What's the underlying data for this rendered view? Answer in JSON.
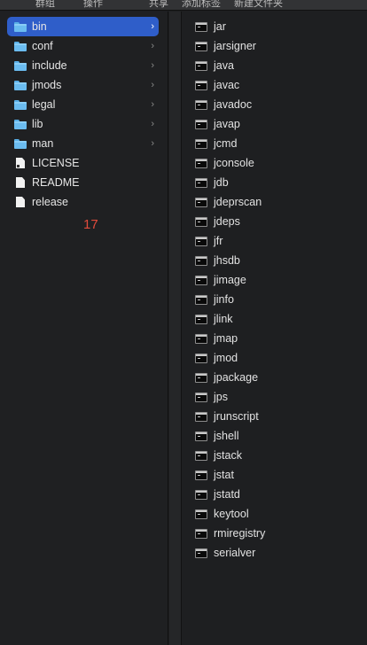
{
  "toolbar": {
    "items": [
      "群组",
      "操作",
      "共享",
      "添加标签",
      "新建文件夹"
    ]
  },
  "sidebar": {
    "items": [
      {
        "label": "bin",
        "kind": "folder",
        "selected": true,
        "has_children": true
      },
      {
        "label": "conf",
        "kind": "folder",
        "selected": false,
        "has_children": true
      },
      {
        "label": "include",
        "kind": "folder",
        "selected": false,
        "has_children": true
      },
      {
        "label": "jmods",
        "kind": "folder",
        "selected": false,
        "has_children": true
      },
      {
        "label": "legal",
        "kind": "folder",
        "selected": false,
        "has_children": true
      },
      {
        "label": "lib",
        "kind": "folder",
        "selected": false,
        "has_children": true
      },
      {
        "label": "man",
        "kind": "folder",
        "selected": false,
        "has_children": true
      },
      {
        "label": "LICENSE",
        "kind": "file",
        "selected": false,
        "has_children": false
      },
      {
        "label": "README",
        "kind": "file",
        "selected": false,
        "has_children": false
      },
      {
        "label": "release",
        "kind": "file",
        "selected": false,
        "has_children": false
      }
    ],
    "count": "17"
  },
  "executables": {
    "items": [
      "jar",
      "jarsigner",
      "java",
      "javac",
      "javadoc",
      "javap",
      "jcmd",
      "jconsole",
      "jdb",
      "jdeprscan",
      "jdeps",
      "jfr",
      "jhsdb",
      "jimage",
      "jinfo",
      "jlink",
      "jmap",
      "jmod",
      "jpackage",
      "jps",
      "jrunscript",
      "jshell",
      "jstack",
      "jstat",
      "jstatd",
      "keytool",
      "rmiregistry",
      "serialver"
    ]
  },
  "colors": {
    "selection": "#2f5ec9",
    "count": "#e24b3c",
    "folder": "#6bbcf0"
  },
  "icons": {
    "folder": "folder-icon",
    "file": "document-icon",
    "executable": "terminal-executable-icon",
    "chevron": "chevron-right-icon"
  }
}
